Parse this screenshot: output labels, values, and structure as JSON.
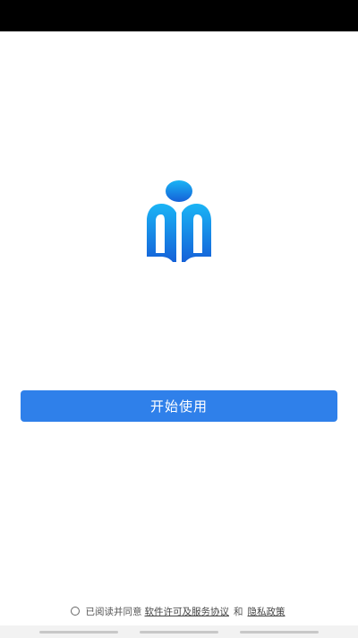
{
  "logo": {
    "icon": "m-person-book-logo",
    "color_top": "#1ab4f5",
    "color_bottom": "#1561d8"
  },
  "actions": {
    "start_label": "开始使用"
  },
  "agreement": {
    "prefix": "已阅读并同意",
    "license_link": "软件许可及服务协议",
    "conjunction": "和",
    "privacy_link": "隐私政策"
  },
  "colors": {
    "primary": "#2f80ea",
    "status_bar": "#000000"
  }
}
